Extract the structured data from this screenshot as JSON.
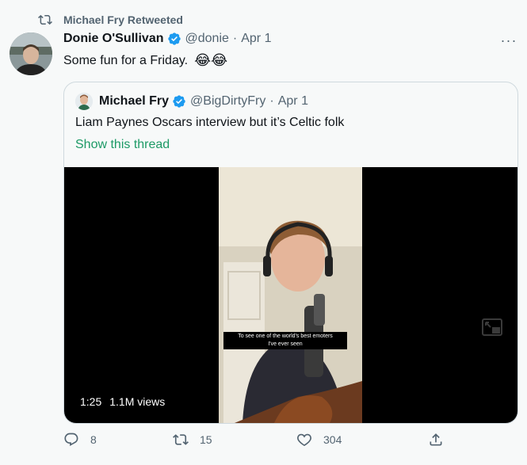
{
  "retweet": {
    "label": "Michael Fry Retweeted",
    "icon": "retweet-icon"
  },
  "tweet": {
    "author_name": "Donie O'Sullivan",
    "handle": "@donie",
    "separator": "·",
    "date": "Apr 1",
    "text": "Some fun for a Friday.",
    "emojis": "😂😂",
    "more_icon": "more-icon",
    "more_label": "···"
  },
  "quote": {
    "author_name": "Michael Fry",
    "handle": "@BigDirtyFry",
    "separator": "·",
    "date": "Apr 1",
    "text": "Liam Paynes Oscars interview but it’s Celtic folk",
    "thread_link": "Show this thread"
  },
  "video": {
    "caption_line1": "To see one of the world's best emoters",
    "caption_line2": "I've ever seen",
    "duration": "1:25",
    "views": "1.1M views"
  },
  "actions": {
    "reply_count": "8",
    "retweet_count": "15",
    "like_count": "304"
  },
  "colors": {
    "verified": "#1d9bf0",
    "link": "#1d9a66",
    "muted": "#536471"
  }
}
